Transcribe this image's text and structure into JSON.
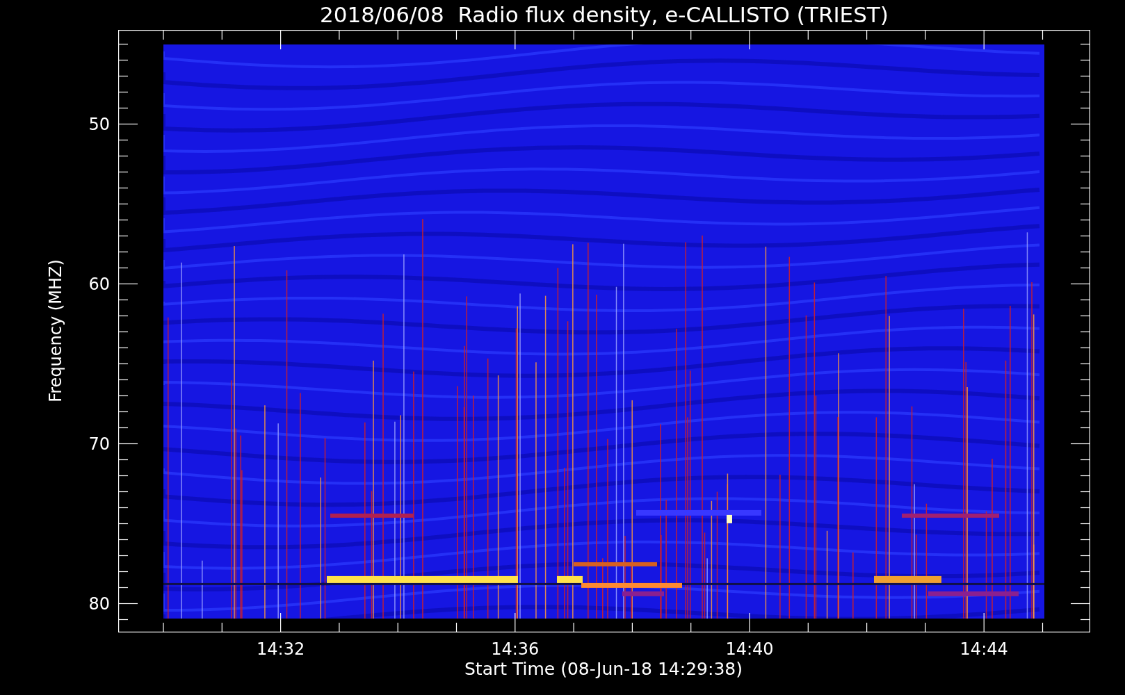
{
  "title": "2018/06/08  Radio flux density, e-CALLISTO (TRIEST)",
  "y_axis": {
    "label": "Frequency (MHZ)",
    "ticks": [
      "50",
      "60",
      "70",
      "80"
    ]
  },
  "x_axis": {
    "label": "Start Time (08-Jun-18 14:29:38)",
    "ticks": [
      "14:32",
      "14:36",
      "14:40",
      "14:44"
    ]
  }
}
